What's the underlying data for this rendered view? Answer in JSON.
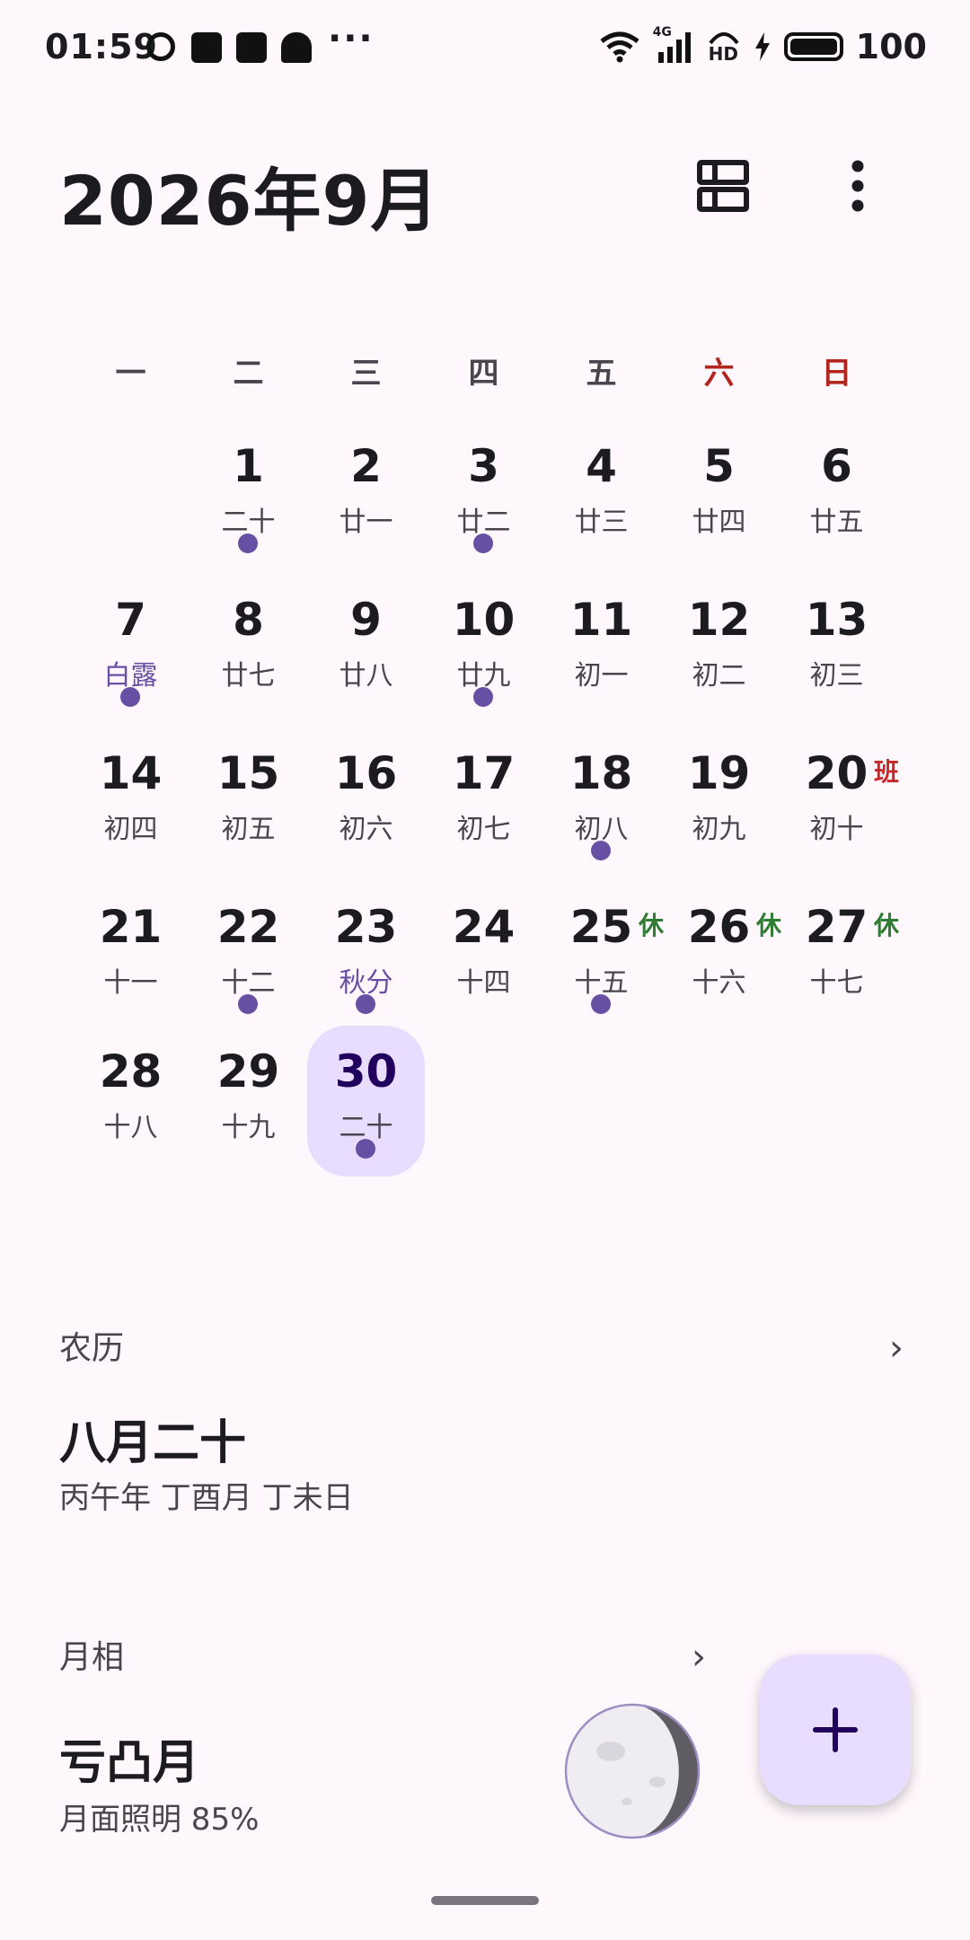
{
  "status_bar": {
    "time": "01:59",
    "network": "4G",
    "hd": "HD",
    "battery": "100",
    "icons": [
      "meituan-icon",
      "bag-icon",
      "bag-check-icon",
      "android-icon",
      "more-notifications-icon",
      "wifi-icon",
      "signal-icon",
      "hd-voice-icon",
      "charging-icon",
      "battery-icon"
    ]
  },
  "header": {
    "title": "2026年9月"
  },
  "weekdays": [
    "一",
    "二",
    "三",
    "四",
    "五",
    "六",
    "日"
  ],
  "calendar": {
    "rows": [
      [
        null,
        {
          "day": "1",
          "lunar": "二十",
          "dot": true
        },
        {
          "day": "2",
          "lunar": "廿一"
        },
        {
          "day": "3",
          "lunar": "廿二",
          "dot": true
        },
        {
          "day": "4",
          "lunar": "廿三"
        },
        {
          "day": "5",
          "lunar": "廿四"
        },
        {
          "day": "6",
          "lunar": "廿五"
        }
      ],
      [
        {
          "day": "7",
          "lunar": "白露",
          "term": true,
          "dot": true
        },
        {
          "day": "8",
          "lunar": "廿七"
        },
        {
          "day": "9",
          "lunar": "廿八"
        },
        {
          "day": "10",
          "lunar": "廿九",
          "dot": true
        },
        {
          "day": "11",
          "lunar": "初一"
        },
        {
          "day": "12",
          "lunar": "初二"
        },
        {
          "day": "13",
          "lunar": "初三"
        }
      ],
      [
        {
          "day": "14",
          "lunar": "初四"
        },
        {
          "day": "15",
          "lunar": "初五"
        },
        {
          "day": "16",
          "lunar": "初六"
        },
        {
          "day": "17",
          "lunar": "初七"
        },
        {
          "day": "18",
          "lunar": "初八",
          "dot": true
        },
        {
          "day": "19",
          "lunar": "初九"
        },
        {
          "day": "20",
          "lunar": "初十",
          "tag": "班",
          "tag_type": "work"
        }
      ],
      [
        {
          "day": "21",
          "lunar": "十一"
        },
        {
          "day": "22",
          "lunar": "十二",
          "dot": true
        },
        {
          "day": "23",
          "lunar": "秋分",
          "term": true,
          "dot": true
        },
        {
          "day": "24",
          "lunar": "十四"
        },
        {
          "day": "25",
          "lunar": "十五",
          "dot": true,
          "tag": "休",
          "tag_type": "rest"
        },
        {
          "day": "26",
          "lunar": "十六",
          "tag": "休",
          "tag_type": "rest"
        },
        {
          "day": "27",
          "lunar": "十七",
          "tag": "休",
          "tag_type": "rest"
        }
      ],
      [
        {
          "day": "28",
          "lunar": "十八"
        },
        {
          "day": "29",
          "lunar": "十九"
        },
        {
          "day": "30",
          "lunar": "二十",
          "dot": true,
          "selected": true
        },
        null,
        null,
        null,
        null
      ]
    ]
  },
  "lunar_section": {
    "label": "农历",
    "chevron": "›",
    "date": "八月二十",
    "ganzhi": "丙午年 丁酉月 丁未日"
  },
  "moon_section": {
    "label": "月相",
    "chevron": "›",
    "phase": "亏凸月",
    "illumination_text": "月面照明 85%",
    "illumination_fraction": 0.85
  },
  "fab": {
    "icon": "plus-icon",
    "label": "+"
  },
  "colors": {
    "background": "#fef7fc",
    "accent": "#6750a4",
    "selected_bg": "#e8ddff",
    "weekend": "#b3261e",
    "rest": "#2e7d32",
    "work": "#c62828"
  }
}
